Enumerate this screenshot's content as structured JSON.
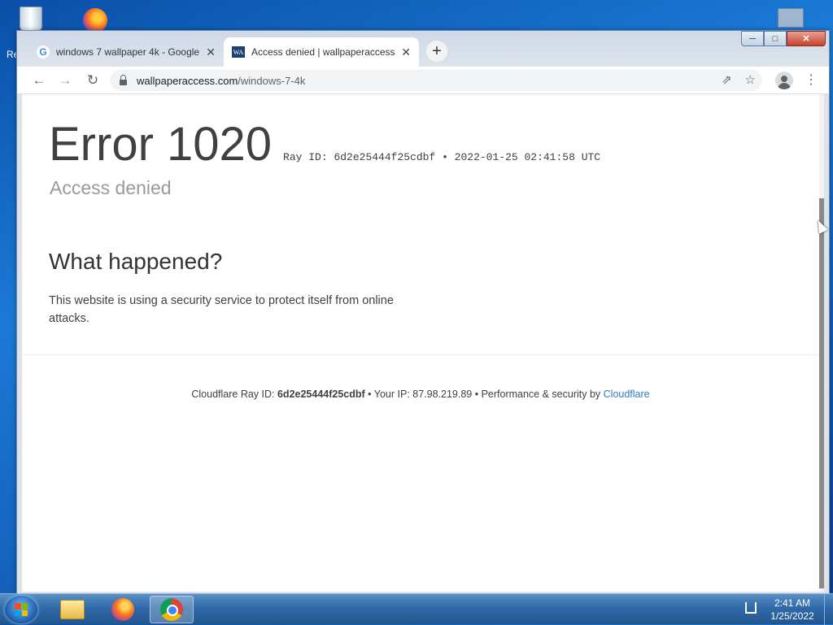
{
  "desktop": {
    "left_edge_labels": [
      "Re"
    ]
  },
  "browser": {
    "tabs": [
      {
        "title": "windows 7 wallpaper 4k - Google",
        "favicon": "google-g-icon",
        "active": false
      },
      {
        "title": "Access denied | wallpaperaccess",
        "favicon": "wallpaperaccess-icon",
        "favicon_text": "WA",
        "active": true
      }
    ],
    "new_tab_symbol": "+",
    "address": {
      "host": "wallpaperaccess.com",
      "path": "/windows-7-4k"
    },
    "nav_icons": [
      "back-icon",
      "forward-icon",
      "reload-icon"
    ],
    "toolbar_icons": [
      "share-icon",
      "bookmark-star-icon",
      "profile-icon",
      "menu-icon"
    ]
  },
  "page": {
    "error_title": "Error 1020",
    "ray_line": "Ray ID: 6d2e25444f25cdbf • 2022-01-25 02:41:58 UTC",
    "subtitle": "Access denied",
    "what_heading": "What happened?",
    "description": "This website is using a security service to protect itself from online attacks.",
    "footer": {
      "ray_label": "Cloudflare Ray ID: ",
      "ray_id": "6d2e25444f25cdbf",
      "ip_text": " • Your IP: 87.98.219.89 • Performance & security by ",
      "cloudflare_link": "Cloudflare"
    }
  },
  "taskbar": {
    "items": [
      "windows-explorer-icon",
      "firefox-icon",
      "chrome-icon"
    ],
    "active_item": "chrome-icon",
    "clock": {
      "time": "2:41 AM",
      "date": "1/25/2022"
    }
  },
  "colors": {
    "link": "#2f7bbf",
    "taskbar": "#2f6aa8"
  }
}
